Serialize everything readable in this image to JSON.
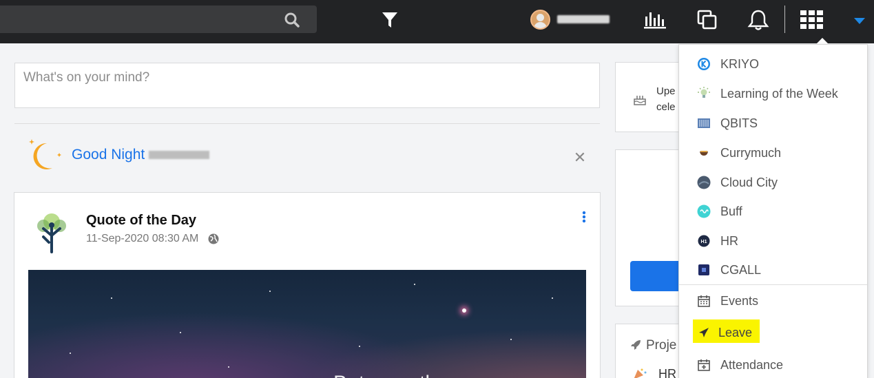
{
  "topbar": {
    "icons": [
      "search-icon",
      "filter-icon",
      "bar-chart-icon",
      "copy-icon",
      "bell-icon",
      "apps-grid-icon",
      "caret-down-icon"
    ],
    "accent": "#1e88e5"
  },
  "composer": {
    "placeholder": "What's on your mind?"
  },
  "greeting": {
    "text": "Good Night"
  },
  "post": {
    "title": "Quote of the Day",
    "timestamp": "11-Sep-2020 08:30 AM",
    "image_text": "Between the sun"
  },
  "right_panel": {
    "upcoming_line1": "Upe",
    "upcoming_line2": "cele",
    "projects_label": "Proje",
    "hr_label": "HR"
  },
  "app_menu": {
    "apps": [
      {
        "label": "KRIYO",
        "icon": "kriyo-icon"
      },
      {
        "label": "Learning of the Week",
        "icon": "lightbulb-icon"
      },
      {
        "label": "QBITS",
        "icon": "qbits-icon"
      },
      {
        "label": "Currymuch",
        "icon": "bowl-icon"
      },
      {
        "label": "Cloud City",
        "icon": "cloud-city-icon"
      },
      {
        "label": "Buff",
        "icon": "buff-icon"
      },
      {
        "label": "HR",
        "icon": "hr-icon"
      },
      {
        "label": "CGALL",
        "icon": "cgall-icon"
      }
    ],
    "tools": [
      {
        "label": "Events",
        "icon": "calendar-icon"
      },
      {
        "label": "Leave",
        "icon": "plane-icon"
      },
      {
        "label": "Attendance",
        "icon": "calendar-plus-icon"
      }
    ],
    "highlight_color": "#faf400"
  }
}
